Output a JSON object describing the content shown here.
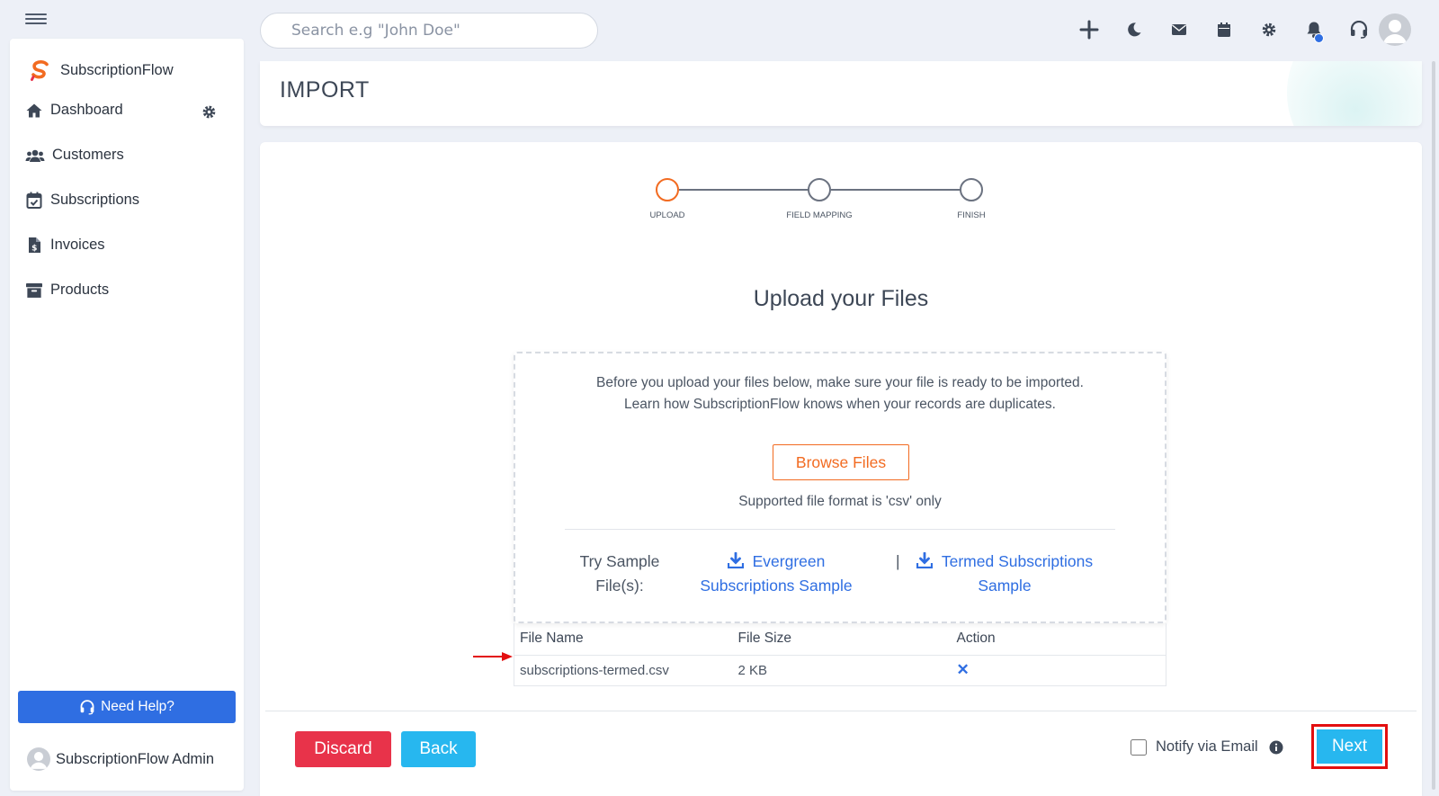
{
  "topbar": {
    "search_placeholder": "Search e.g \"John Doe\"",
    "icons": [
      "plus-icon",
      "moon-icon",
      "mail-icon",
      "calendar-icon",
      "gear-icon",
      "bell-icon",
      "headset-icon"
    ]
  },
  "sidebar": {
    "brand": "SubscriptionFlow",
    "items": [
      {
        "label": "Dashboard",
        "icon": "home-icon"
      },
      {
        "label": "Customers",
        "icon": "users-icon"
      },
      {
        "label": "Subscriptions",
        "icon": "calendar-check-icon"
      },
      {
        "label": "Invoices",
        "icon": "invoice-icon"
      },
      {
        "label": "Products",
        "icon": "archive-icon"
      }
    ],
    "help_label": "Need Help?",
    "user_name": "SubscriptionFlow Admin"
  },
  "header": {
    "title": "IMPORT"
  },
  "stepper": {
    "steps": [
      "UPLOAD",
      "FIELD MAPPING",
      "FINISH"
    ],
    "active_index": 0
  },
  "upload": {
    "title": "Upload your Files",
    "intro_line1": "Before you upload your files below, make sure your file is ready to be imported.",
    "intro_line2": "Learn how SubscriptionFlow knows when your records are duplicates.",
    "browse_label": "Browse Files",
    "format_note": "Supported file format is 'csv' only",
    "try_label_1": "Try Sample",
    "try_label_2": "File(s):",
    "sample1_line1": "Evergreen",
    "sample1_line2": "Subscriptions Sample",
    "separator": "|",
    "sample2_line1": "Termed Subscriptions",
    "sample2_line2": "Sample"
  },
  "file_table": {
    "headers": [
      "File Name",
      "File Size",
      "Action"
    ],
    "rows": [
      {
        "name": "subscriptions-termed.csv",
        "size": "2 KB",
        "action": "✕"
      }
    ]
  },
  "footer": {
    "discard_label": "Discard",
    "back_label": "Back",
    "notify_label": "Notify via Email",
    "next_label": "Next"
  },
  "colors": {
    "accent_blue": "#2f6ee2",
    "brand_orange": "#f26b21",
    "discard_red": "#e8334a",
    "cyan": "#27b7ef",
    "highlight_red": "#e30f10"
  }
}
